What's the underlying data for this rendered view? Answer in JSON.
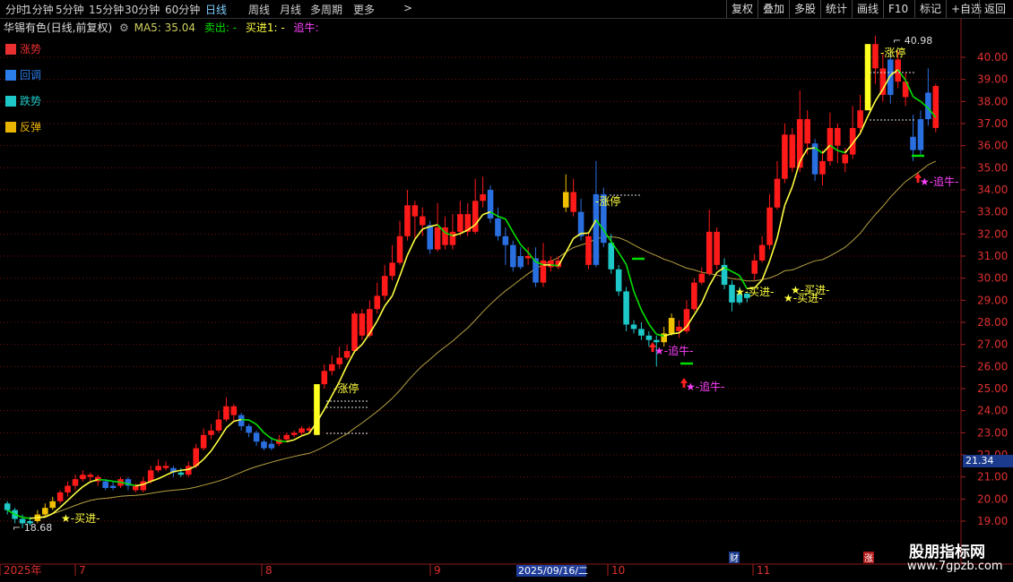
{
  "toolbar": {
    "periods": [
      {
        "label": "分时"
      },
      {
        "label": "1分钟"
      },
      {
        "label": "5分钟"
      },
      {
        "label": "15分钟"
      },
      {
        "label": "30分钟"
      },
      {
        "label": "60分钟"
      },
      {
        "label": "日线",
        "active": true
      },
      {
        "label": "周线"
      },
      {
        "label": "月线"
      },
      {
        "label": "多周期"
      },
      {
        "label": "更多"
      }
    ],
    "more_arrow": ">",
    "right_buttons": [
      {
        "label": "复权"
      },
      {
        "label": "叠加"
      },
      {
        "label": "多股"
      },
      {
        "label": "统计"
      },
      {
        "label": "画线"
      },
      {
        "label": "F10"
      },
      {
        "label": "标记"
      },
      {
        "label": "+自选"
      },
      {
        "label": "返回"
      }
    ]
  },
  "info": {
    "title": "华锡有色(日线,前复权)",
    "indicator": "MA5: 35.04",
    "sell": "卖出: -",
    "buy": "买进1: -",
    "chase": "追牛:"
  },
  "legend": [
    {
      "label": "涨势",
      "color": "#e83030"
    },
    {
      "label": "回调",
      "color": "#2b7de9"
    },
    {
      "label": "跌势",
      "color": "#1ec8c8"
    },
    {
      "label": "反弹",
      "color": "#e8b400"
    }
  ],
  "axis": {
    "y_ticks": [
      "40.00",
      "39.00",
      "38.00",
      "37.00",
      "36.00",
      "35.00",
      "34.00",
      "33.00",
      "32.00",
      "31.00",
      "30.00",
      "29.00",
      "28.00",
      "27.00",
      "26.00",
      "25.00",
      "24.00",
      "23.00",
      "22.00",
      "21.00",
      "20.00",
      "19.00"
    ],
    "current_price": "21.34",
    "x_labels": [
      "2025年",
      "7",
      "8",
      "9",
      "10",
      "11"
    ],
    "x_highlight": "2025/09/16/二",
    "x_markers": [
      "财",
      "涨"
    ]
  },
  "annotations": {
    "high": "40.98",
    "low": "18.68",
    "limit_up": "涨停",
    "buy": "买进",
    "chase": "追牛"
  },
  "watermark": {
    "name": "股朋指标网",
    "url": "www.7gpzb.com"
  },
  "colors": {
    "up": "#ff1a1a",
    "down": "#2a6fe0",
    "teal": "#1ec8c8",
    "gold": "#f0c000",
    "ma": "#00e000",
    "ma_long": "#b5a040",
    "magenta": "#ff40ff",
    "yellow": "#ffff40"
  },
  "chart_data": {
    "type": "candlestick",
    "yrange": [
      18.4,
      41.2
    ],
    "candles": [
      {
        "o": 19.8,
        "c": 19.5,
        "h": 19.9,
        "l": 19.3,
        "k": "teal"
      },
      {
        "o": 19.5,
        "c": 19.1,
        "h": 19.6,
        "l": 18.9,
        "k": "teal"
      },
      {
        "o": 19.1,
        "c": 18.9,
        "h": 19.3,
        "l": 18.68,
        "k": "teal"
      },
      {
        "o": 18.9,
        "c": 19.0,
        "h": 19.2,
        "l": 18.8,
        "k": "teal"
      },
      {
        "o": 19.0,
        "c": 19.3,
        "h": 19.5,
        "l": 18.9,
        "k": "gold"
      },
      {
        "o": 19.3,
        "c": 19.6,
        "h": 19.8,
        "l": 19.2,
        "k": "gold"
      },
      {
        "o": 19.6,
        "c": 19.9,
        "h": 20.1,
        "l": 19.5,
        "k": "gold"
      },
      {
        "o": 19.9,
        "c": 20.3,
        "h": 20.4,
        "l": 19.8,
        "k": "up"
      },
      {
        "o": 20.3,
        "c": 20.6,
        "h": 20.8,
        "l": 20.1,
        "k": "up"
      },
      {
        "o": 20.6,
        "c": 20.9,
        "h": 21.1,
        "l": 20.4,
        "k": "up"
      },
      {
        "o": 20.9,
        "c": 21.1,
        "h": 21.3,
        "l": 20.8,
        "k": "up"
      },
      {
        "o": 21.1,
        "c": 21.0,
        "h": 21.2,
        "l": 20.8,
        "k": "up"
      },
      {
        "o": 21.0,
        "c": 20.8,
        "h": 21.1,
        "l": 20.6,
        "k": "up"
      },
      {
        "o": 20.8,
        "c": 20.5,
        "h": 20.9,
        "l": 20.4,
        "k": "down"
      },
      {
        "o": 20.5,
        "c": 20.6,
        "h": 20.8,
        "l": 20.4,
        "k": "down"
      },
      {
        "o": 20.6,
        "c": 20.9,
        "h": 21.0,
        "l": 20.5,
        "k": "up"
      },
      {
        "o": 20.9,
        "c": 20.6,
        "h": 21.0,
        "l": 20.4,
        "k": "down"
      },
      {
        "o": 20.6,
        "c": 20.4,
        "h": 20.7,
        "l": 20.3,
        "k": "up"
      },
      {
        "o": 20.4,
        "c": 20.8,
        "h": 21.0,
        "l": 20.3,
        "k": "up"
      },
      {
        "o": 20.8,
        "c": 21.3,
        "h": 21.5,
        "l": 20.7,
        "k": "up"
      },
      {
        "o": 21.3,
        "c": 21.5,
        "h": 21.8,
        "l": 21.2,
        "k": "up"
      },
      {
        "o": 21.5,
        "c": 21.4,
        "h": 21.7,
        "l": 21.3,
        "k": "up"
      },
      {
        "o": 21.4,
        "c": 21.2,
        "h": 21.5,
        "l": 21.0,
        "k": "down"
      },
      {
        "o": 21.2,
        "c": 21.1,
        "h": 21.4,
        "l": 21.0,
        "k": "teal"
      },
      {
        "o": 21.1,
        "c": 21.5,
        "h": 21.7,
        "l": 21.0,
        "k": "up"
      },
      {
        "o": 21.5,
        "c": 22.3,
        "h": 22.5,
        "l": 21.4,
        "k": "up"
      },
      {
        "o": 22.3,
        "c": 22.9,
        "h": 23.2,
        "l": 22.2,
        "k": "up"
      },
      {
        "o": 22.9,
        "c": 23.1,
        "h": 23.4,
        "l": 22.7,
        "k": "up"
      },
      {
        "o": 23.1,
        "c": 23.6,
        "h": 24.0,
        "l": 23.0,
        "k": "up"
      },
      {
        "o": 23.6,
        "c": 24.2,
        "h": 24.6,
        "l": 23.5,
        "k": "up"
      },
      {
        "o": 24.2,
        "c": 23.8,
        "h": 24.3,
        "l": 23.5,
        "k": "up"
      },
      {
        "o": 23.8,
        "c": 23.3,
        "h": 23.9,
        "l": 23.1,
        "k": "down"
      },
      {
        "o": 23.3,
        "c": 23.0,
        "h": 23.4,
        "l": 22.8,
        "k": "down"
      },
      {
        "o": 23.0,
        "c": 22.6,
        "h": 23.1,
        "l": 22.4,
        "k": "down"
      },
      {
        "o": 22.6,
        "c": 22.3,
        "h": 22.7,
        "l": 22.2,
        "k": "down"
      },
      {
        "o": 22.3,
        "c": 22.5,
        "h": 22.8,
        "l": 22.2,
        "k": "down"
      },
      {
        "o": 22.5,
        "c": 22.7,
        "h": 22.9,
        "l": 22.4,
        "k": "up"
      },
      {
        "o": 22.7,
        "c": 22.9,
        "h": 23.0,
        "l": 22.6,
        "k": "up"
      },
      {
        "o": 22.9,
        "c": 23.0,
        "h": 23.1,
        "l": 22.8,
        "k": "up"
      },
      {
        "o": 23.0,
        "c": 23.2,
        "h": 23.3,
        "l": 22.9,
        "k": "up"
      },
      {
        "o": 23.2,
        "c": 23.1,
        "h": 23.3,
        "l": 23.0,
        "k": "up"
      },
      {
        "o": 22.9,
        "c": 25.2,
        "h": 25.2,
        "l": 22.9,
        "k": "gold"
      },
      {
        "o": 25.2,
        "c": 25.8,
        "h": 26.1,
        "l": 25.0,
        "k": "up"
      },
      {
        "o": 25.8,
        "c": 26.1,
        "h": 26.5,
        "l": 25.6,
        "k": "up"
      },
      {
        "o": 26.1,
        "c": 26.4,
        "h": 26.9,
        "l": 25.9,
        "k": "up"
      },
      {
        "o": 26.4,
        "c": 26.7,
        "h": 27.0,
        "l": 26.3,
        "k": "up"
      },
      {
        "o": 26.7,
        "c": 28.4,
        "h": 28.5,
        "l": 26.6,
        "k": "up"
      },
      {
        "o": 28.4,
        "c": 27.4,
        "h": 28.6,
        "l": 27.2,
        "k": "up"
      },
      {
        "o": 27.4,
        "c": 28.6,
        "h": 29.0,
        "l": 27.3,
        "k": "up"
      },
      {
        "o": 28.6,
        "c": 29.2,
        "h": 29.8,
        "l": 28.4,
        "k": "up"
      },
      {
        "o": 29.2,
        "c": 30.1,
        "h": 30.6,
        "l": 29.0,
        "k": "up"
      },
      {
        "o": 30.1,
        "c": 30.7,
        "h": 31.5,
        "l": 29.9,
        "k": "up"
      },
      {
        "o": 30.7,
        "c": 31.9,
        "h": 32.6,
        "l": 30.6,
        "k": "up"
      },
      {
        "o": 31.9,
        "c": 33.3,
        "h": 34.0,
        "l": 31.7,
        "k": "up"
      },
      {
        "o": 33.3,
        "c": 32.8,
        "h": 33.5,
        "l": 31.8,
        "k": "up"
      },
      {
        "o": 32.8,
        "c": 32.4,
        "h": 33.2,
        "l": 31.9,
        "k": "up"
      },
      {
        "o": 32.4,
        "c": 31.3,
        "h": 32.6,
        "l": 31.1,
        "k": "down"
      },
      {
        "o": 31.3,
        "c": 32.3,
        "h": 33.4,
        "l": 31.2,
        "k": "up"
      },
      {
        "o": 32.3,
        "c": 31.5,
        "h": 32.8,
        "l": 31.3,
        "k": "up"
      },
      {
        "o": 31.5,
        "c": 32.1,
        "h": 32.9,
        "l": 31.3,
        "k": "up"
      },
      {
        "o": 32.1,
        "c": 32.9,
        "h": 33.5,
        "l": 31.9,
        "k": "up"
      },
      {
        "o": 32.9,
        "c": 32.1,
        "h": 33.4,
        "l": 31.9,
        "k": "up"
      },
      {
        "o": 32.1,
        "c": 33.5,
        "h": 34.5,
        "l": 32.0,
        "k": "up"
      },
      {
        "o": 33.5,
        "c": 33.8,
        "h": 34.6,
        "l": 33.2,
        "k": "up"
      },
      {
        "o": 34.0,
        "c": 32.7,
        "h": 34.2,
        "l": 32.5,
        "k": "down"
      },
      {
        "o": 32.7,
        "c": 31.9,
        "h": 33.2,
        "l": 31.7,
        "k": "down"
      },
      {
        "o": 31.9,
        "c": 31.5,
        "h": 32.3,
        "l": 30.6,
        "k": "down"
      },
      {
        "o": 31.5,
        "c": 30.5,
        "h": 31.7,
        "l": 30.3,
        "k": "down"
      },
      {
        "o": 30.5,
        "c": 31.0,
        "h": 31.4,
        "l": 30.4,
        "k": "down"
      },
      {
        "o": 31.0,
        "c": 30.9,
        "h": 31.4,
        "l": 30.6,
        "k": "up"
      },
      {
        "o": 30.9,
        "c": 29.8,
        "h": 31.4,
        "l": 29.6,
        "k": "down"
      },
      {
        "o": 29.8,
        "c": 30.8,
        "h": 31.6,
        "l": 29.6,
        "k": "up"
      },
      {
        "o": 30.8,
        "c": 30.5,
        "h": 31.0,
        "l": 30.3,
        "k": "up"
      },
      {
        "o": 30.5,
        "c": 30.8,
        "h": 31.0,
        "l": 30.4,
        "k": "up"
      },
      {
        "o": 33.2,
        "c": 33.9,
        "h": 34.7,
        "l": 33.0,
        "k": "gold"
      },
      {
        "o": 33.9,
        "c": 33.0,
        "h": 34.5,
        "l": 32.8,
        "k": "up"
      },
      {
        "o": 33.0,
        "c": 31.9,
        "h": 33.6,
        "l": 31.7,
        "k": "down"
      },
      {
        "o": 31.9,
        "c": 30.6,
        "h": 32.1,
        "l": 30.4,
        "k": "up"
      },
      {
        "o": 30.6,
        "c": 33.8,
        "h": 35.3,
        "l": 30.5,
        "k": "down"
      },
      {
        "o": 33.8,
        "c": 31.6,
        "h": 34.1,
        "l": 31.4,
        "k": "down"
      },
      {
        "o": 31.6,
        "c": 30.4,
        "h": 32.0,
        "l": 30.2,
        "k": "teal"
      },
      {
        "o": 30.4,
        "c": 29.4,
        "h": 30.6,
        "l": 29.2,
        "k": "teal"
      },
      {
        "o": 29.4,
        "c": 27.9,
        "h": 29.6,
        "l": 27.6,
        "k": "teal"
      },
      {
        "o": 27.9,
        "c": 27.7,
        "h": 28.1,
        "l": 27.5,
        "k": "teal"
      },
      {
        "o": 27.7,
        "c": 27.4,
        "h": 28.0,
        "l": 27.2,
        "k": "teal"
      },
      {
        "o": 27.4,
        "c": 27.2,
        "h": 27.6,
        "l": 26.9,
        "k": "teal"
      },
      {
        "o": 27.2,
        "c": 27.1,
        "h": 27.4,
        "l": 26.0,
        "k": "teal"
      },
      {
        "o": 27.1,
        "c": 27.5,
        "h": 27.8,
        "l": 26.9,
        "k": "gold"
      },
      {
        "o": 27.5,
        "c": 28.2,
        "h": 28.4,
        "l": 27.4,
        "k": "gold"
      },
      {
        "o": 27.8,
        "c": 27.6,
        "h": 28.1,
        "l": 27.3,
        "k": "up"
      },
      {
        "o": 27.6,
        "c": 28.6,
        "h": 29.0,
        "l": 27.5,
        "k": "up"
      },
      {
        "o": 28.6,
        "c": 29.8,
        "h": 30.0,
        "l": 28.5,
        "k": "up"
      },
      {
        "o": 29.8,
        "c": 30.2,
        "h": 30.5,
        "l": 29.7,
        "k": "up"
      },
      {
        "o": 30.2,
        "c": 32.1,
        "h": 33.1,
        "l": 30.1,
        "k": "up"
      },
      {
        "o": 32.1,
        "c": 30.6,
        "h": 32.3,
        "l": 30.4,
        "k": "up"
      },
      {
        "o": 30.6,
        "c": 29.7,
        "h": 30.9,
        "l": 29.5,
        "k": "teal"
      },
      {
        "o": 29.7,
        "c": 28.9,
        "h": 29.9,
        "l": 28.5,
        "k": "teal"
      },
      {
        "o": 28.9,
        "c": 29.3,
        "h": 29.6,
        "l": 28.8,
        "k": "teal"
      },
      {
        "o": 29.3,
        "c": 29.1,
        "h": 29.4,
        "l": 28.9,
        "k": "teal"
      },
      {
        "o": 30.2,
        "c": 30.8,
        "h": 31.1,
        "l": 29.9,
        "k": "up"
      },
      {
        "o": 30.8,
        "c": 31.5,
        "h": 31.9,
        "l": 30.7,
        "k": "up"
      },
      {
        "o": 31.5,
        "c": 33.2,
        "h": 33.8,
        "l": 31.3,
        "k": "up"
      },
      {
        "o": 33.2,
        "c": 34.5,
        "h": 35.3,
        "l": 33.1,
        "k": "up"
      },
      {
        "o": 34.5,
        "c": 36.5,
        "h": 37.0,
        "l": 34.3,
        "k": "up"
      },
      {
        "o": 36.5,
        "c": 35.0,
        "h": 36.8,
        "l": 34.8,
        "k": "up"
      },
      {
        "o": 35.0,
        "c": 37.2,
        "h": 38.5,
        "l": 34.8,
        "k": "up"
      },
      {
        "o": 37.2,
        "c": 36.1,
        "h": 37.6,
        "l": 35.6,
        "k": "up"
      },
      {
        "o": 36.1,
        "c": 34.7,
        "h": 36.3,
        "l": 34.4,
        "k": "down"
      },
      {
        "o": 34.7,
        "c": 35.3,
        "h": 35.8,
        "l": 34.2,
        "k": "up"
      },
      {
        "o": 35.3,
        "c": 36.8,
        "h": 37.5,
        "l": 35.1,
        "k": "up"
      },
      {
        "o": 36.8,
        "c": 36.0,
        "h": 37.0,
        "l": 35.2,
        "k": "up"
      },
      {
        "o": 35.2,
        "c": 35.6,
        "h": 35.9,
        "l": 34.8,
        "k": "up"
      },
      {
        "o": 35.6,
        "c": 36.8,
        "h": 37.8,
        "l": 35.4,
        "k": "up"
      },
      {
        "o": 36.8,
        "c": 37.6,
        "h": 38.3,
        "l": 36.5,
        "k": "up"
      },
      {
        "o": 37.6,
        "c": 40.6,
        "h": 40.6,
        "l": 37.6,
        "k": "gold"
      },
      {
        "o": 40.6,
        "c": 39.5,
        "h": 40.98,
        "l": 38.8,
        "k": "up"
      },
      {
        "o": 39.5,
        "c": 38.3,
        "h": 40.2,
        "l": 38.0,
        "k": "up"
      },
      {
        "o": 38.3,
        "c": 39.9,
        "h": 40.2,
        "l": 37.9,
        "k": "down"
      },
      {
        "o": 39.9,
        "c": 38.9,
        "h": 40.3,
        "l": 38.6,
        "k": "up"
      },
      {
        "o": 38.9,
        "c": 38.2,
        "h": 39.3,
        "l": 37.8,
        "k": "up"
      },
      {
        "o": 36.4,
        "c": 35.8,
        "h": 37.4,
        "l": 35.3,
        "k": "down"
      },
      {
        "o": 35.8,
        "c": 37.2,
        "h": 37.6,
        "l": 35.6,
        "k": "down"
      },
      {
        "o": 37.2,
        "c": 38.4,
        "h": 39.5,
        "l": 36.9,
        "k": "down"
      },
      {
        "o": 38.7,
        "c": 36.8,
        "h": 38.8,
        "l": 36.6,
        "k": "up"
      }
    ]
  }
}
